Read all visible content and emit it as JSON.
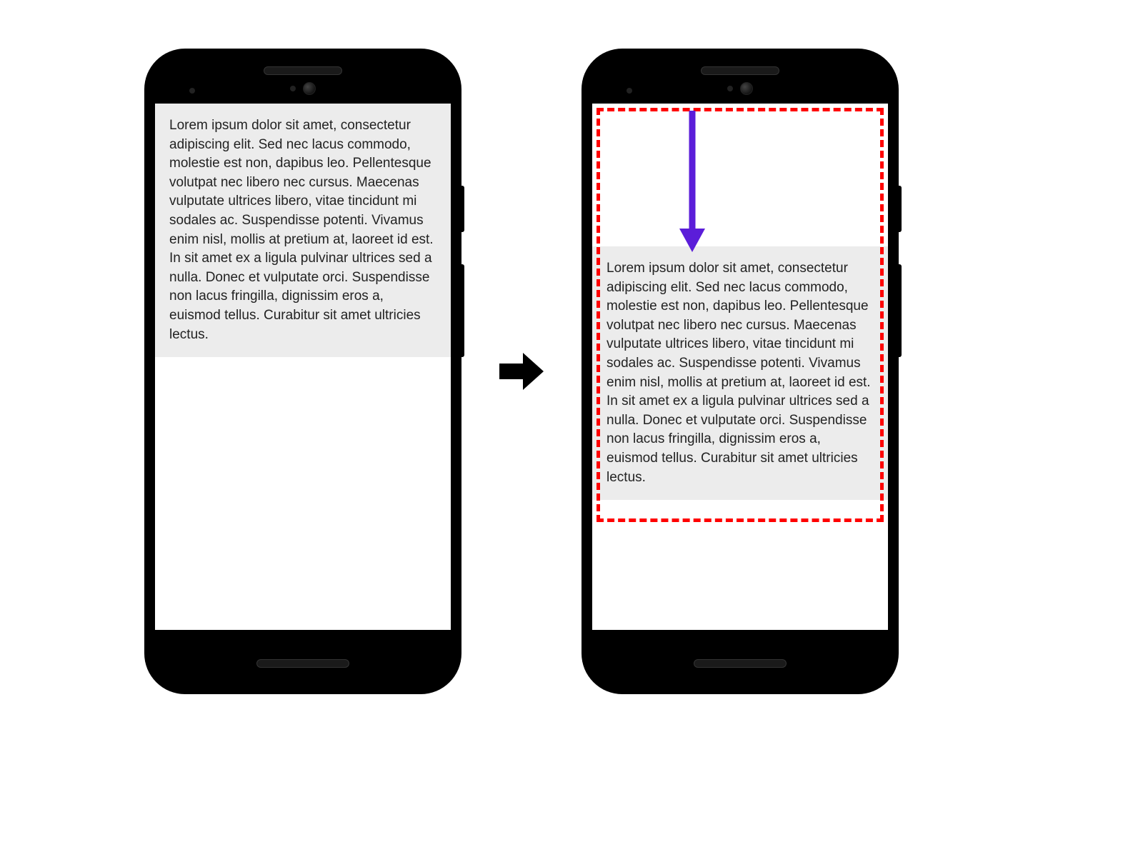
{
  "text_content": "Lorem ipsum dolor sit amet, consectetur adipiscing elit. Sed nec lacus commodo, molestie est non, dapibus leo. Pellentesque volutpat nec libero nec cursus. Maecenas vulputate ultrices libero, vitae tincidunt mi sodales ac. Suspendisse potenti. Vivamus enim nisl, mollis at pretium at, laoreet id est. In sit amet ex a ligula pulvinar ultrices sed a nulla. Donec et vulputate orci. Suspendisse non lacus fringilla, dignissim eros a, euismod tellus. Curabitur sit amet ultricies lectus.",
  "colors": {
    "highlight_border": "#ff0000",
    "arrow": "#5b1dd9",
    "text_bg": "#ececec"
  }
}
